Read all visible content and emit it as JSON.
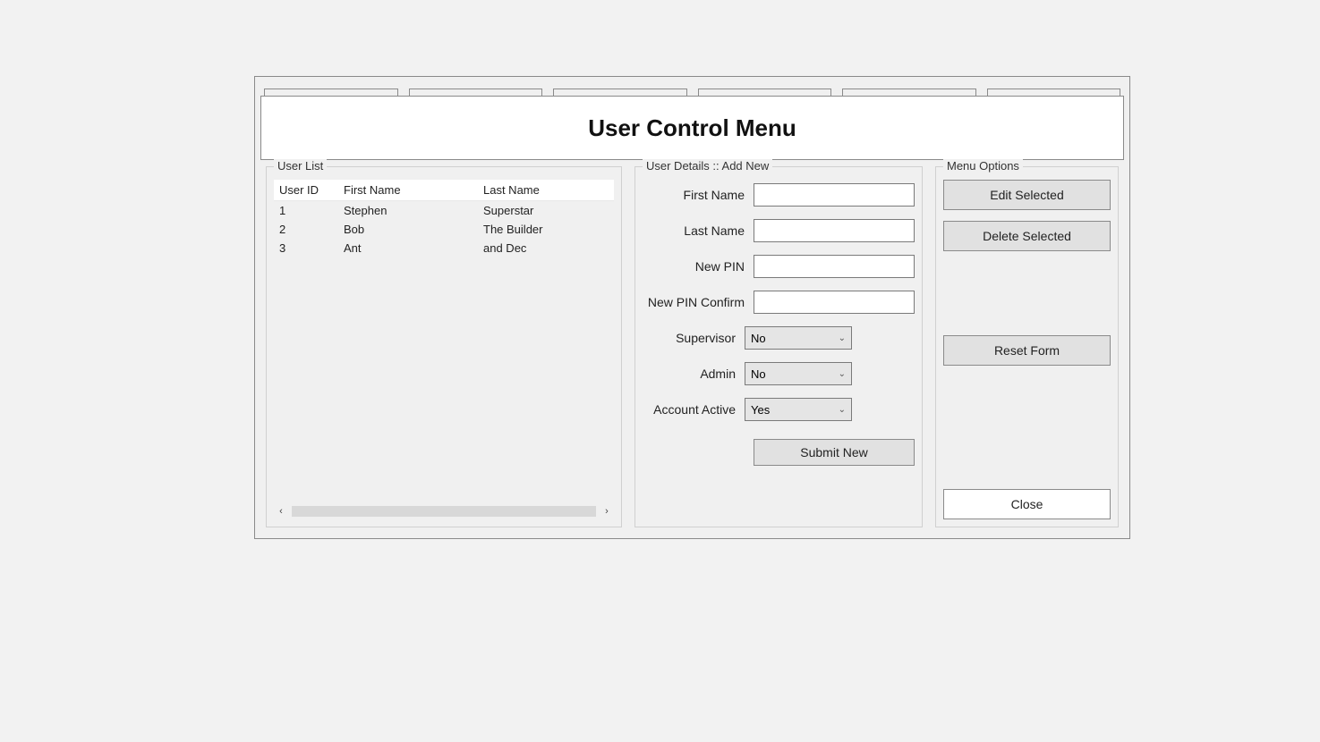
{
  "window_title": "User Control Menu",
  "user_list": {
    "legend": "User List",
    "columns": [
      "User ID",
      "First Name",
      "Last Name"
    ],
    "rows": [
      {
        "id": "1",
        "first_name": "Stephen",
        "last_name": "Superstar"
      },
      {
        "id": "2",
        "first_name": "Bob",
        "last_name": "The Builder"
      },
      {
        "id": "3",
        "first_name": "Ant",
        "last_name": "and Dec"
      }
    ]
  },
  "details": {
    "legend": "User Details :: Add New",
    "labels": {
      "first_name": "First Name",
      "last_name": "Last Name",
      "new_pin": "New PIN",
      "new_pin_confirm": "New PIN Confirm",
      "supervisor": "Supervisor",
      "admin": "Admin",
      "account_active": "Account Active"
    },
    "values": {
      "first_name": "",
      "last_name": "",
      "new_pin": "",
      "new_pin_confirm": "",
      "supervisor": "No",
      "admin": "No",
      "account_active": "Yes"
    },
    "submit_label": "Submit New"
  },
  "menu_options": {
    "legend": "Menu Options",
    "edit_label": "Edit Selected",
    "delete_label": "Delete Selected",
    "reset_label": "Reset Form",
    "close_label": "Close"
  }
}
